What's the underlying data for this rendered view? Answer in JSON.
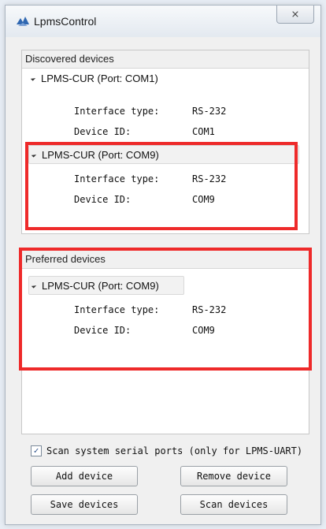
{
  "window": {
    "title": "LpmsControl",
    "close_glyph": "⨯"
  },
  "discovered": {
    "header": "Discovered devices",
    "devices": [
      {
        "label": "LPMS-CUR (Port: COM1)",
        "props": [
          {
            "label": "Interface type:",
            "value": "RS-232"
          },
          {
            "label": "Device ID:",
            "value": "COM1"
          }
        ]
      },
      {
        "label": "LPMS-CUR (Port: COM9)",
        "props": [
          {
            "label": "Interface type:",
            "value": "RS-232"
          },
          {
            "label": "Device ID:",
            "value": "COM9"
          }
        ]
      }
    ]
  },
  "preferred": {
    "header": "Preferred devices",
    "devices": [
      {
        "label": "LPMS-CUR (Port: COM9)",
        "props": [
          {
            "label": "Interface type:",
            "value": "RS-232"
          },
          {
            "label": "Device ID:",
            "value": "COM9"
          }
        ]
      }
    ]
  },
  "scan_checkbox": {
    "label": "Scan system serial ports (only for LPMS-UART)",
    "checked": true
  },
  "buttons": {
    "add": "Add device",
    "remove": "Remove device",
    "save": "Save devices",
    "scan": "Scan devices"
  },
  "colors": {
    "highlight": "#ee2a2a"
  }
}
